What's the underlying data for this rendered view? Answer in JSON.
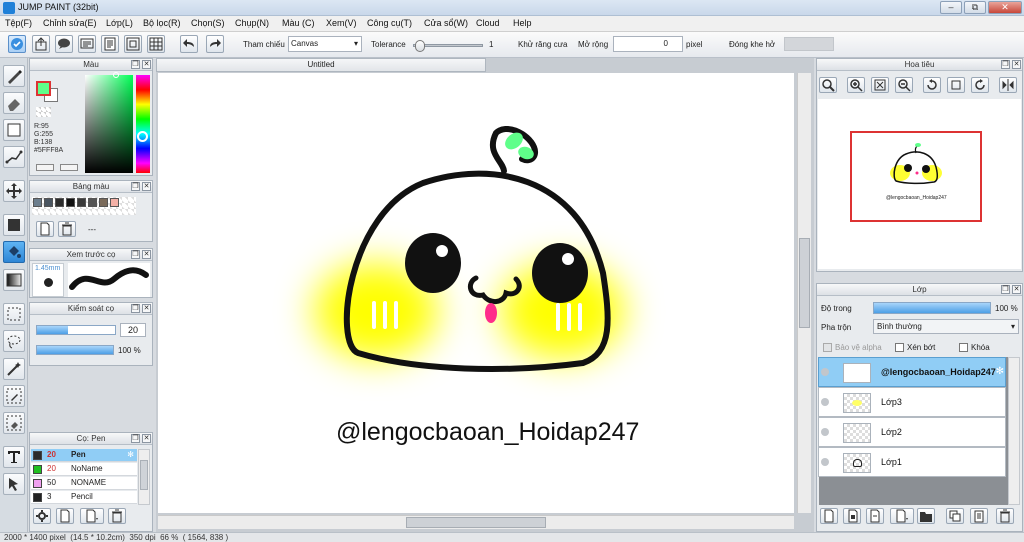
{
  "window": {
    "title": "JUMP PAINT (32bit)",
    "min": "–",
    "restore": "⧉",
    "close": "✕"
  },
  "menu": [
    "Tệp(F)",
    "Chỉnh sửa(E)",
    "Lớp(L)",
    "Bộ lọc(R)",
    "Chọn(S)",
    "Chụp(N)",
    "Màu (C)",
    "Xem(V)",
    "Công cụ(T)",
    "Cửa sổ(W)",
    "Cloud",
    "Help"
  ],
  "toolbar": {
    "reference_label": "Tham chiếu",
    "reference_value": "Canvas",
    "tolerance_label": "Tolerance",
    "tolerance_value": "1",
    "antialias_label": "Khử răng cưa",
    "antialias_checked": "✕",
    "expand_label": "Mở rộng",
    "expand_value": "0",
    "expand_unit": "pixel",
    "close_gap_label": "Đóng khe hở",
    "tolerance_fraction": 0.02
  },
  "color_panel": {
    "title": "Màu",
    "r": "R:95",
    "g": "G:255",
    "b": "B:138",
    "hex": "#5FFF8A",
    "current_color": "#5fff8a"
  },
  "palette_panel": {
    "title": "Bảng màu",
    "dash": "---",
    "swatches": [
      "#6b7d8c",
      "#4a5560",
      "#2c2c2c",
      "#111111",
      "#3a3a3a",
      "#555555",
      "#7a6a5a",
      "#f3b0a6"
    ]
  },
  "brush_preview": {
    "title": "Xem trước cọ",
    "size": "1.45mm"
  },
  "brush_control": {
    "title": "Kiểm soát cọ",
    "size_value": "20",
    "opacity_value": "100 %",
    "size_fraction": 0.4,
    "opacity_fraction": 1.0
  },
  "brush_list": {
    "title": "Cọ: Pen",
    "items": [
      {
        "size": "20",
        "name": "Pen",
        "color": "#2c2c2c",
        "sel": true
      },
      {
        "size": "20",
        "name": "NoName",
        "color": "#20c020",
        "sel": false
      },
      {
        "size": "50",
        "name": "NONAME",
        "color": "#f0a0f0",
        "sel": false
      },
      {
        "size": "3",
        "name": "Pencil",
        "color": "#222222",
        "sel": false
      }
    ]
  },
  "document": {
    "tab_title": "Untitled",
    "watermark": "@lengocbaoan_Hoidap247"
  },
  "navigator": {
    "title": "Hoa tiêu",
    "watermark": "@lengocbaoan_Hoidap247"
  },
  "layers": {
    "title": "Lớp",
    "opacity_label": "Độ trong",
    "opacity_value": "100 %",
    "opacity_fraction": 1.0,
    "blend_label": "Pha trộn",
    "blend_value": "Bình thường",
    "protect_alpha": "Bảo vệ alpha",
    "clip": "Xén bớt",
    "lock": "Khóa",
    "items": [
      {
        "name": "@lengocbaoan_Hoidap247",
        "sel": true
      },
      {
        "name": "Lớp3",
        "sel": false
      },
      {
        "name": "Lớp2",
        "sel": false
      },
      {
        "name": "Lớp1",
        "sel": false
      }
    ]
  },
  "status": {
    "text": "2000 * 1400 pixel  (14.5 * 10.2cm)  350 dpi  66 %  ( 1564, 838 )"
  },
  "colors": {
    "accent": "#2e86d6",
    "glow": "#ffff00",
    "leaf": "#5fff8a",
    "tongue": "#ff2d8a"
  }
}
